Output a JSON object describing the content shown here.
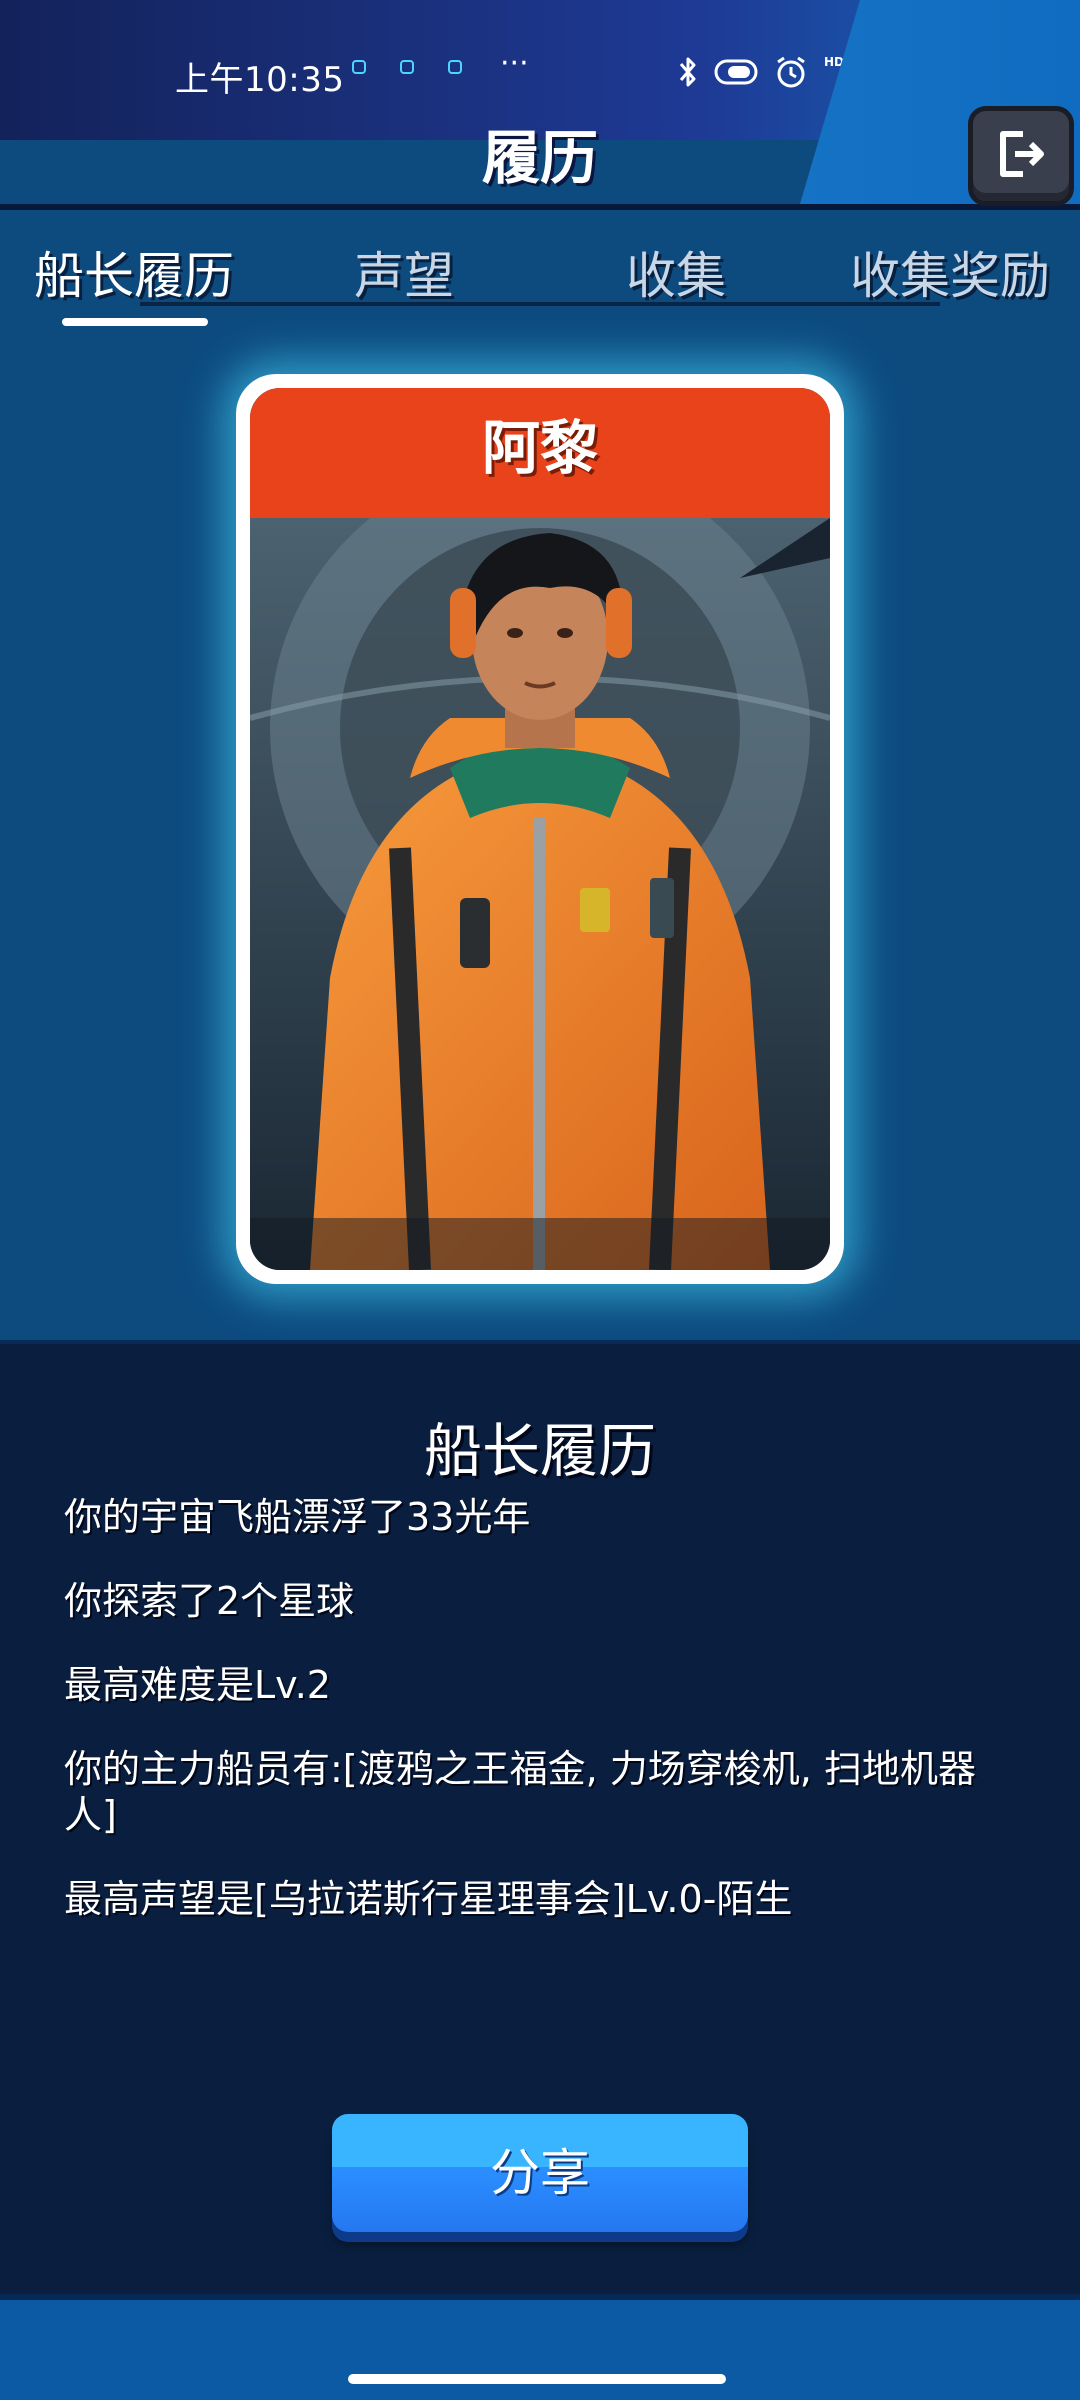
{
  "status_bar": {
    "time": "上午10:35",
    "more": "···",
    "network_label": "HD",
    "battery": "69",
    "icons": [
      "notification-icon",
      "bluetooth-icon",
      "vibrate-icon",
      "alarm-icon",
      "signal-icon",
      "wifi-icon",
      "battery-icon"
    ]
  },
  "header": {
    "title": "履历",
    "exit_icon": "exit-icon"
  },
  "tabs": [
    {
      "label": "船长履历",
      "active": true
    },
    {
      "label": "声望",
      "active": false
    },
    {
      "label": "收集",
      "active": false
    },
    {
      "label": "收集奖励",
      "active": false
    }
  ],
  "card": {
    "name": "阿黎",
    "accent_color": "#e8431a"
  },
  "resume": {
    "title": "船长履历",
    "lines": [
      "你的宇宙飞船漂浮了33光年",
      "你探索了2个星球",
      "最高难度是Lv.2",
      "你的主力船员有:[渡鸦之王福金, 力场穿梭机, 扫地机器人]",
      "最高声望是[乌拉诺斯行星理事会]Lv.0-陌生"
    ]
  },
  "share_button": {
    "label": "分享"
  },
  "colors": {
    "background": "#0d4b7f",
    "panel": "#0a1f3f",
    "share": "#2b8fff",
    "glow": "#48dcff"
  }
}
